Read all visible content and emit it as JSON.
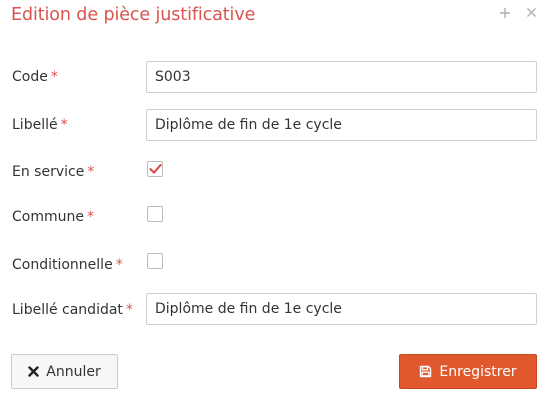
{
  "dialog": {
    "title": "Edition de pièce justificative",
    "colors": {
      "accent": "#d9534f",
      "save_bg": "#e0582e"
    }
  },
  "header_icons": [
    "plus-icon",
    "close-icon"
  ],
  "form": {
    "code": {
      "label": "Code",
      "required": "*",
      "value": "S003"
    },
    "libelle": {
      "label": "Libellé",
      "required": "*",
      "value": "Diplôme de fin de 1e cycle"
    },
    "en_service": {
      "label": "En service",
      "required": "*",
      "checked": true
    },
    "commune": {
      "label": "Commune",
      "required": "*",
      "checked": false
    },
    "conditionnelle": {
      "label": "Conditionnelle",
      "required": "*",
      "checked": false
    },
    "libelle_candidat": {
      "label": "Libellé candidat",
      "required": "*",
      "value": "Diplôme de fin de 1e cycle"
    }
  },
  "buttons": {
    "cancel": {
      "label": "Annuler",
      "icon": "times-icon"
    },
    "save": {
      "label": "Enregistrer",
      "icon": "floppy-disk-icon"
    }
  }
}
